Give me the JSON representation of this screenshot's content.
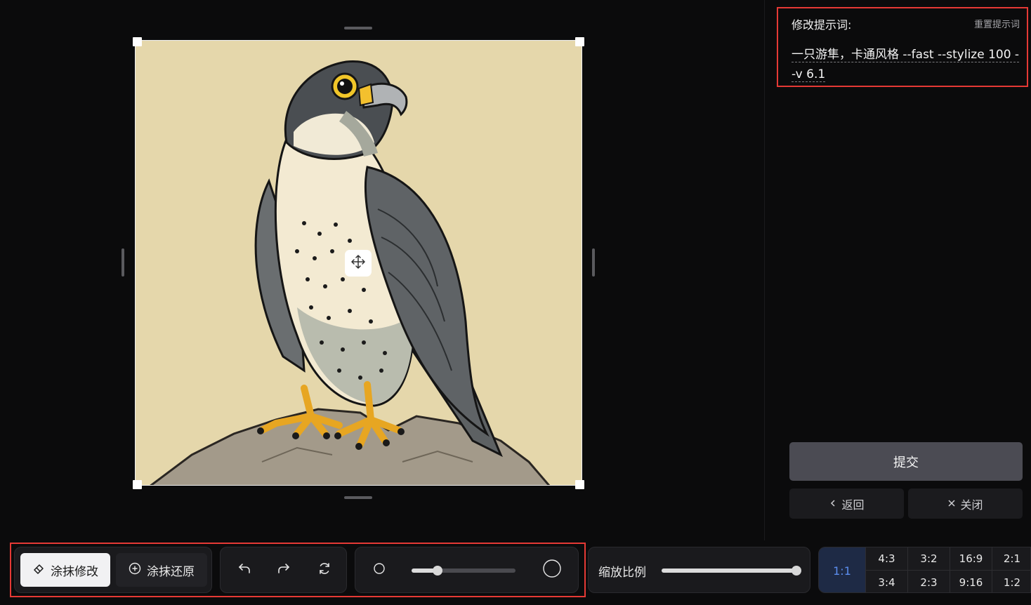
{
  "prompt_panel": {
    "label": "修改提示词:",
    "reset_label": "重置提示词",
    "prompt_text_line1": "一只游隼，卡通风格 --fast --stylize 100 -",
    "prompt_text_line2": "-v 6.1"
  },
  "actions": {
    "submit_label": "提交",
    "back_label": "返回",
    "close_label": "关闭"
  },
  "toolbar": {
    "smear_edit_label": "涂抹修改",
    "smear_restore_label": "涂抹还原",
    "brush_size_fraction": 0.25,
    "zoom_label": "缩放比例",
    "zoom_fraction": 1.0
  },
  "ratios": {
    "selected": "1:1",
    "top_row": [
      "4:3",
      "3:2",
      "16:9",
      "2:1"
    ],
    "bottom_row": [
      "3:4",
      "2:3",
      "9:16",
      "1:2"
    ]
  },
  "colors": {
    "accent_blue": "#5b8dee",
    "highlight_red": "#e53935",
    "image_background": "#e5d7ab"
  },
  "icons": [
    "eraser-icon",
    "plus-circle-icon",
    "undo-icon",
    "redo-icon",
    "refresh-icon",
    "brush-small-icon",
    "brush-large-icon",
    "move-icon",
    "chevron-left-icon",
    "close-icon"
  ]
}
